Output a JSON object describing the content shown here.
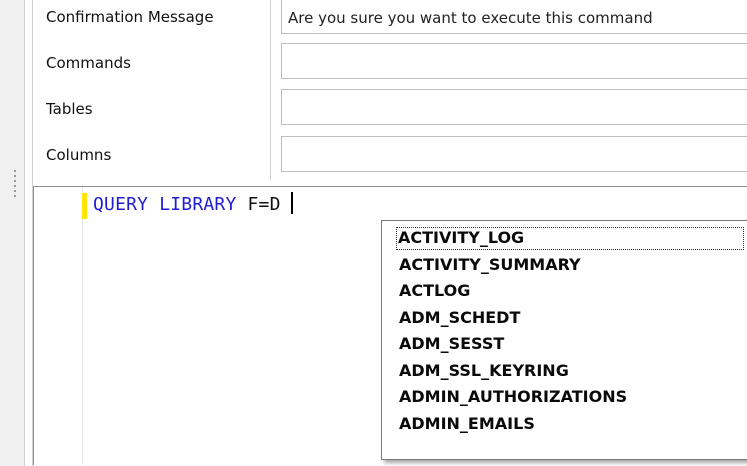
{
  "form": {
    "confirmation_label": "Confirmation Message",
    "confirmation_value": "Are you sure you want to execute this command",
    "commands_label": "Commands",
    "commands_value": "",
    "tables_label": "Tables",
    "tables_value": "",
    "columns_label": "Columns",
    "columns_value": ""
  },
  "editor": {
    "keyword_text": "QUERY LIBRARY",
    "plain_text": " F=D",
    "change_bar_color": "#ffe600"
  },
  "autocomplete": {
    "items": [
      "ACTIVITY_LOG",
      "ACTIVITY_SUMMARY",
      "ACTLOG",
      "ADM_SCHEDT",
      "ADM_SESST",
      "ADM_SSL_KEYRING",
      "ADMIN_AUTHORIZATIONS",
      "ADMIN_EMAILS"
    ],
    "selected_index": 0
  }
}
